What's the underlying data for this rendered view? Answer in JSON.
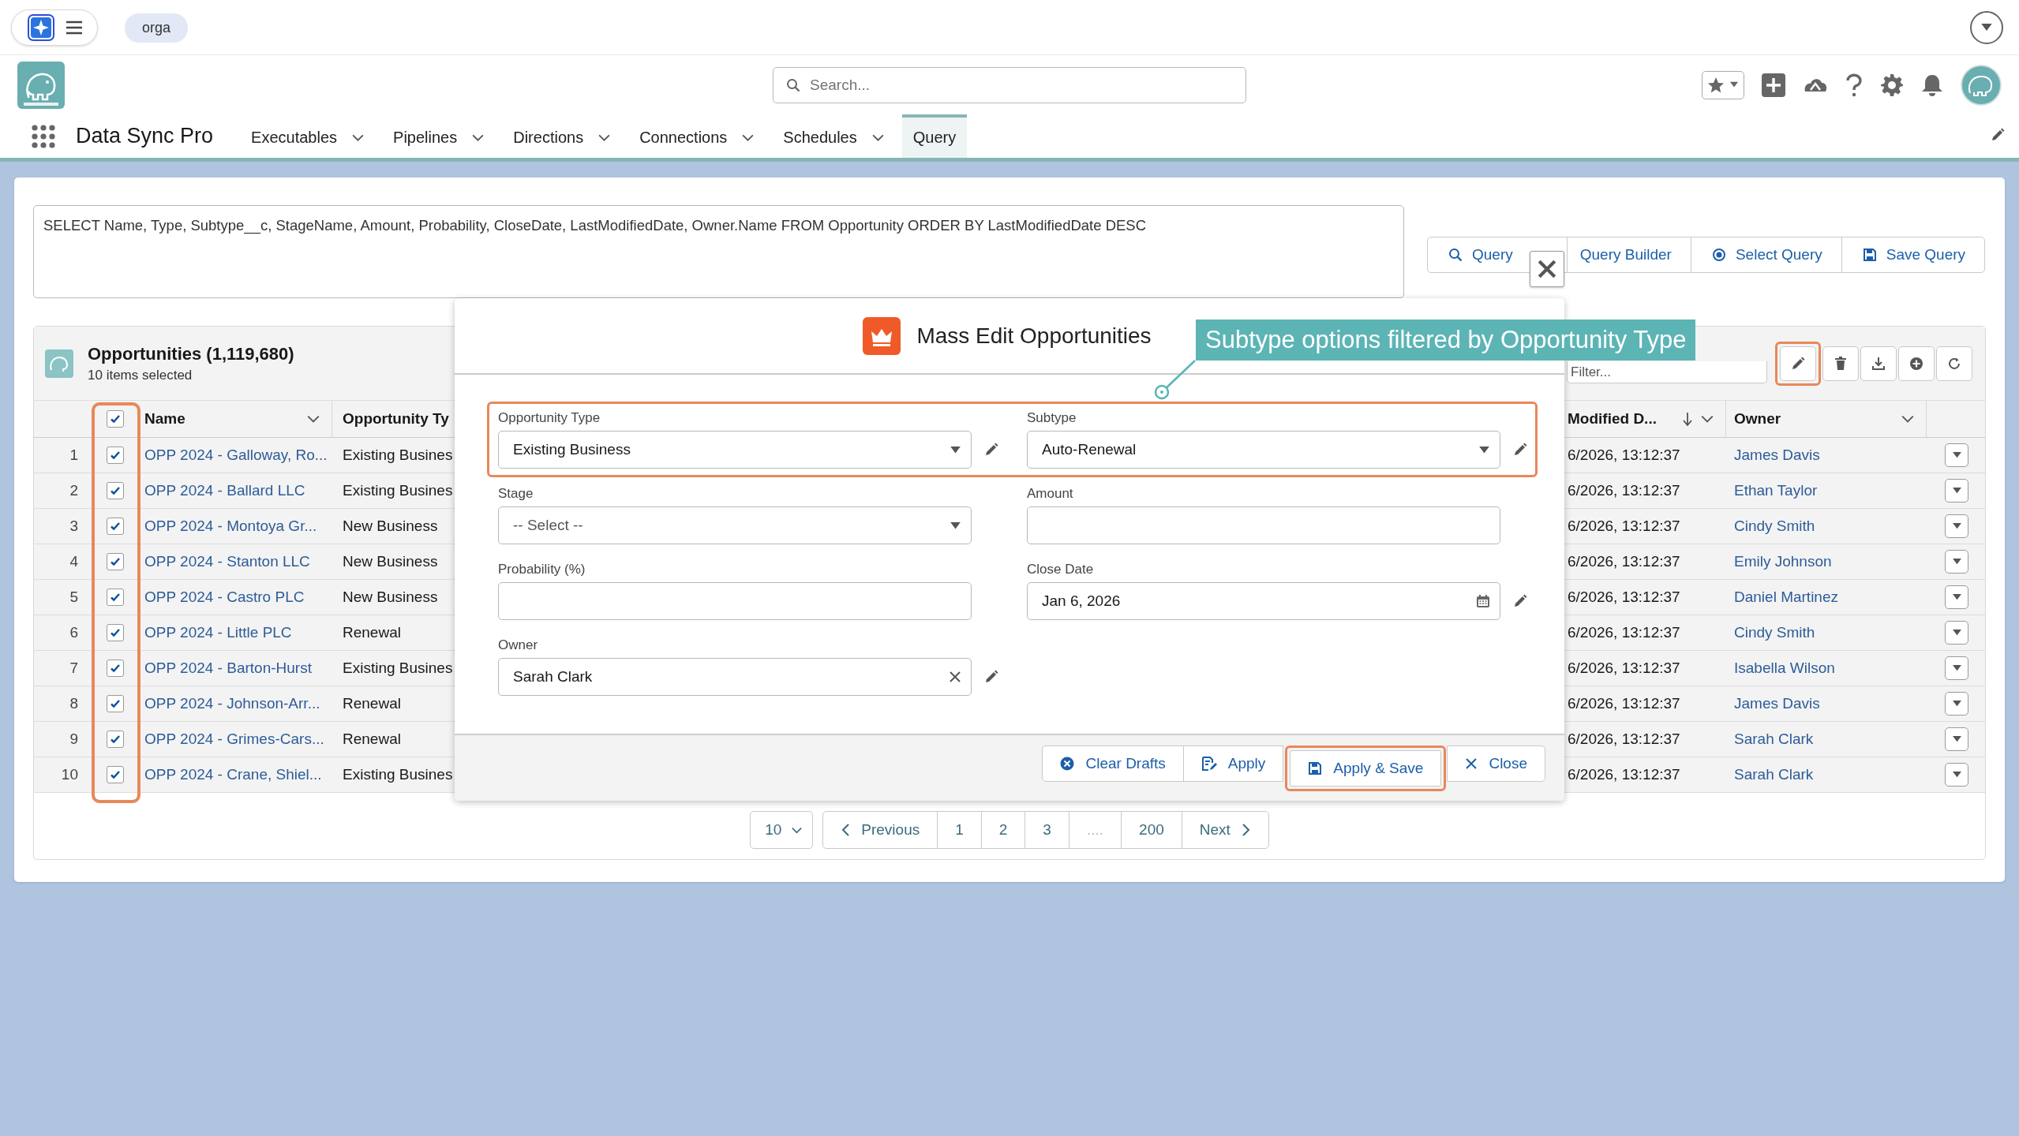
{
  "top_bar": {
    "org_badge": "orga"
  },
  "header": {
    "search": {
      "placeholder": "Search..."
    }
  },
  "nav": {
    "app_name": "Data Sync Pro",
    "tabs": [
      {
        "label": "Executables",
        "has_menu": true,
        "selected": false
      },
      {
        "label": "Pipelines",
        "has_menu": true,
        "selected": false
      },
      {
        "label": "Directions",
        "has_menu": true,
        "selected": false
      },
      {
        "label": "Connections",
        "has_menu": true,
        "selected": false
      },
      {
        "label": "Schedules",
        "has_menu": true,
        "selected": false
      },
      {
        "label": "Query",
        "has_menu": false,
        "selected": true
      }
    ]
  },
  "query": {
    "text": "SELECT Name, Type, Subtype__c, StageName, Amount, Probability, CloseDate, LastModifiedDate, Owner.Name FROM Opportunity ORDER BY LastModifiedDate DESC",
    "buttons": [
      {
        "label": "Query",
        "kind": "search"
      },
      {
        "label": "Query Builder",
        "kind": "plain"
      },
      {
        "label": "Select Query",
        "kind": "select"
      },
      {
        "label": "Save Query",
        "kind": "save"
      }
    ]
  },
  "table": {
    "title": "Opportunities (1,119,680)",
    "subtitle": "10 items selected",
    "filter": {
      "placeholder": "Filter..."
    },
    "toolbar": [
      {
        "kind": "edit",
        "highlighted": true
      },
      {
        "kind": "delete",
        "highlighted": false
      },
      {
        "kind": "download",
        "highlighted": false
      },
      {
        "kind": "add",
        "highlighted": false
      },
      {
        "kind": "refresh",
        "highlighted": false
      }
    ],
    "header_checked": true,
    "checkbox_column_highlighted": true,
    "columns": {
      "name": "Name",
      "type": "Opportunity Ty",
      "modified": "Modified D...",
      "owner": "Owner"
    },
    "rows": [
      {
        "number": "1",
        "checked": true,
        "name": "OPP 2024 - Galloway, Ro...",
        "type": "Existing Busines",
        "modified": "6/2026, 13:12:37",
        "owner": "James Davis"
      },
      {
        "number": "2",
        "checked": true,
        "name": "OPP 2024 - Ballard LLC",
        "type": "Existing Busines",
        "modified": "6/2026, 13:12:37",
        "owner": "Ethan Taylor"
      },
      {
        "number": "3",
        "checked": true,
        "name": "OPP 2024 - Montoya Gr...",
        "type": "New Business",
        "modified": "6/2026, 13:12:37",
        "owner": "Cindy Smith"
      },
      {
        "number": "4",
        "checked": true,
        "name": "OPP 2024 - Stanton LLC",
        "type": "New Business",
        "modified": "6/2026, 13:12:37",
        "owner": "Emily Johnson"
      },
      {
        "number": "5",
        "checked": true,
        "name": "OPP 2024 - Castro PLC",
        "type": "New Business",
        "modified": "6/2026, 13:12:37",
        "owner": "Daniel Martinez"
      },
      {
        "number": "6",
        "checked": true,
        "name": "OPP 2024 - Little PLC",
        "type": "Renewal",
        "modified": "6/2026, 13:12:37",
        "owner": "Cindy Smith"
      },
      {
        "number": "7",
        "checked": true,
        "name": "OPP 2024 - Barton-Hurst",
        "type": "Existing Busines",
        "modified": "6/2026, 13:12:37",
        "owner": "Isabella Wilson"
      },
      {
        "number": "8",
        "checked": true,
        "name": "OPP 2024 - Johnson-Arr...",
        "type": "Renewal",
        "modified": "6/2026, 13:12:37",
        "owner": "James Davis"
      },
      {
        "number": "9",
        "checked": true,
        "name": "OPP 2024 - Grimes-Cars...",
        "type": "Renewal",
        "modified": "6/2026, 13:12:37",
        "owner": "Sarah Clark"
      },
      {
        "number": "10",
        "checked": true,
        "name": "OPP 2024 - Crane, Shiel...",
        "type": "Existing Busines",
        "modified": "6/2026, 13:12:37",
        "owner": "Sarah Clark"
      }
    ]
  },
  "pagination": {
    "page_size": "10",
    "previous": "Previous",
    "next": "Next",
    "pages": [
      {
        "label": "1",
        "disabled": false
      },
      {
        "label": "2",
        "disabled": false
      },
      {
        "label": "3",
        "disabled": false
      },
      {
        "label": "....",
        "disabled": true
      },
      {
        "label": "200",
        "disabled": false
      }
    ]
  },
  "modal": {
    "title": "Mass Edit Opportunities",
    "type_row_highlighted": true,
    "fields": [
      {
        "label": "Opportunity Type",
        "kind": "select",
        "value": "Existing Business",
        "edited": true
      },
      {
        "label": "Subtype",
        "kind": "select",
        "value": "Auto-Renewal",
        "edited": true
      },
      {
        "label": "Stage",
        "kind": "select",
        "placeholder": "-- Select --",
        "edited": false
      },
      {
        "label": "Amount",
        "kind": "text",
        "edited": false
      },
      {
        "label": "Probability (%)",
        "kind": "text",
        "edited": false
      },
      {
        "label": "Close Date",
        "kind": "date",
        "value": "Jan 6, 2026",
        "edited": true
      },
      {
        "label": "Owner",
        "kind": "lookup",
        "value": "Sarah Clark",
        "edited": true
      }
    ],
    "buttons": [
      {
        "label": "Clear Drafts",
        "kind": "clear",
        "highlighted": false
      },
      {
        "label": "Apply",
        "kind": "apply",
        "highlighted": false
      },
      {
        "label": "Apply & Save",
        "kind": "save",
        "highlighted": true
      },
      {
        "label": "Close",
        "kind": "close",
        "highlighted": false
      }
    ]
  },
  "callout": {
    "text": "Subtype options filtered by Opportunity Type"
  }
}
